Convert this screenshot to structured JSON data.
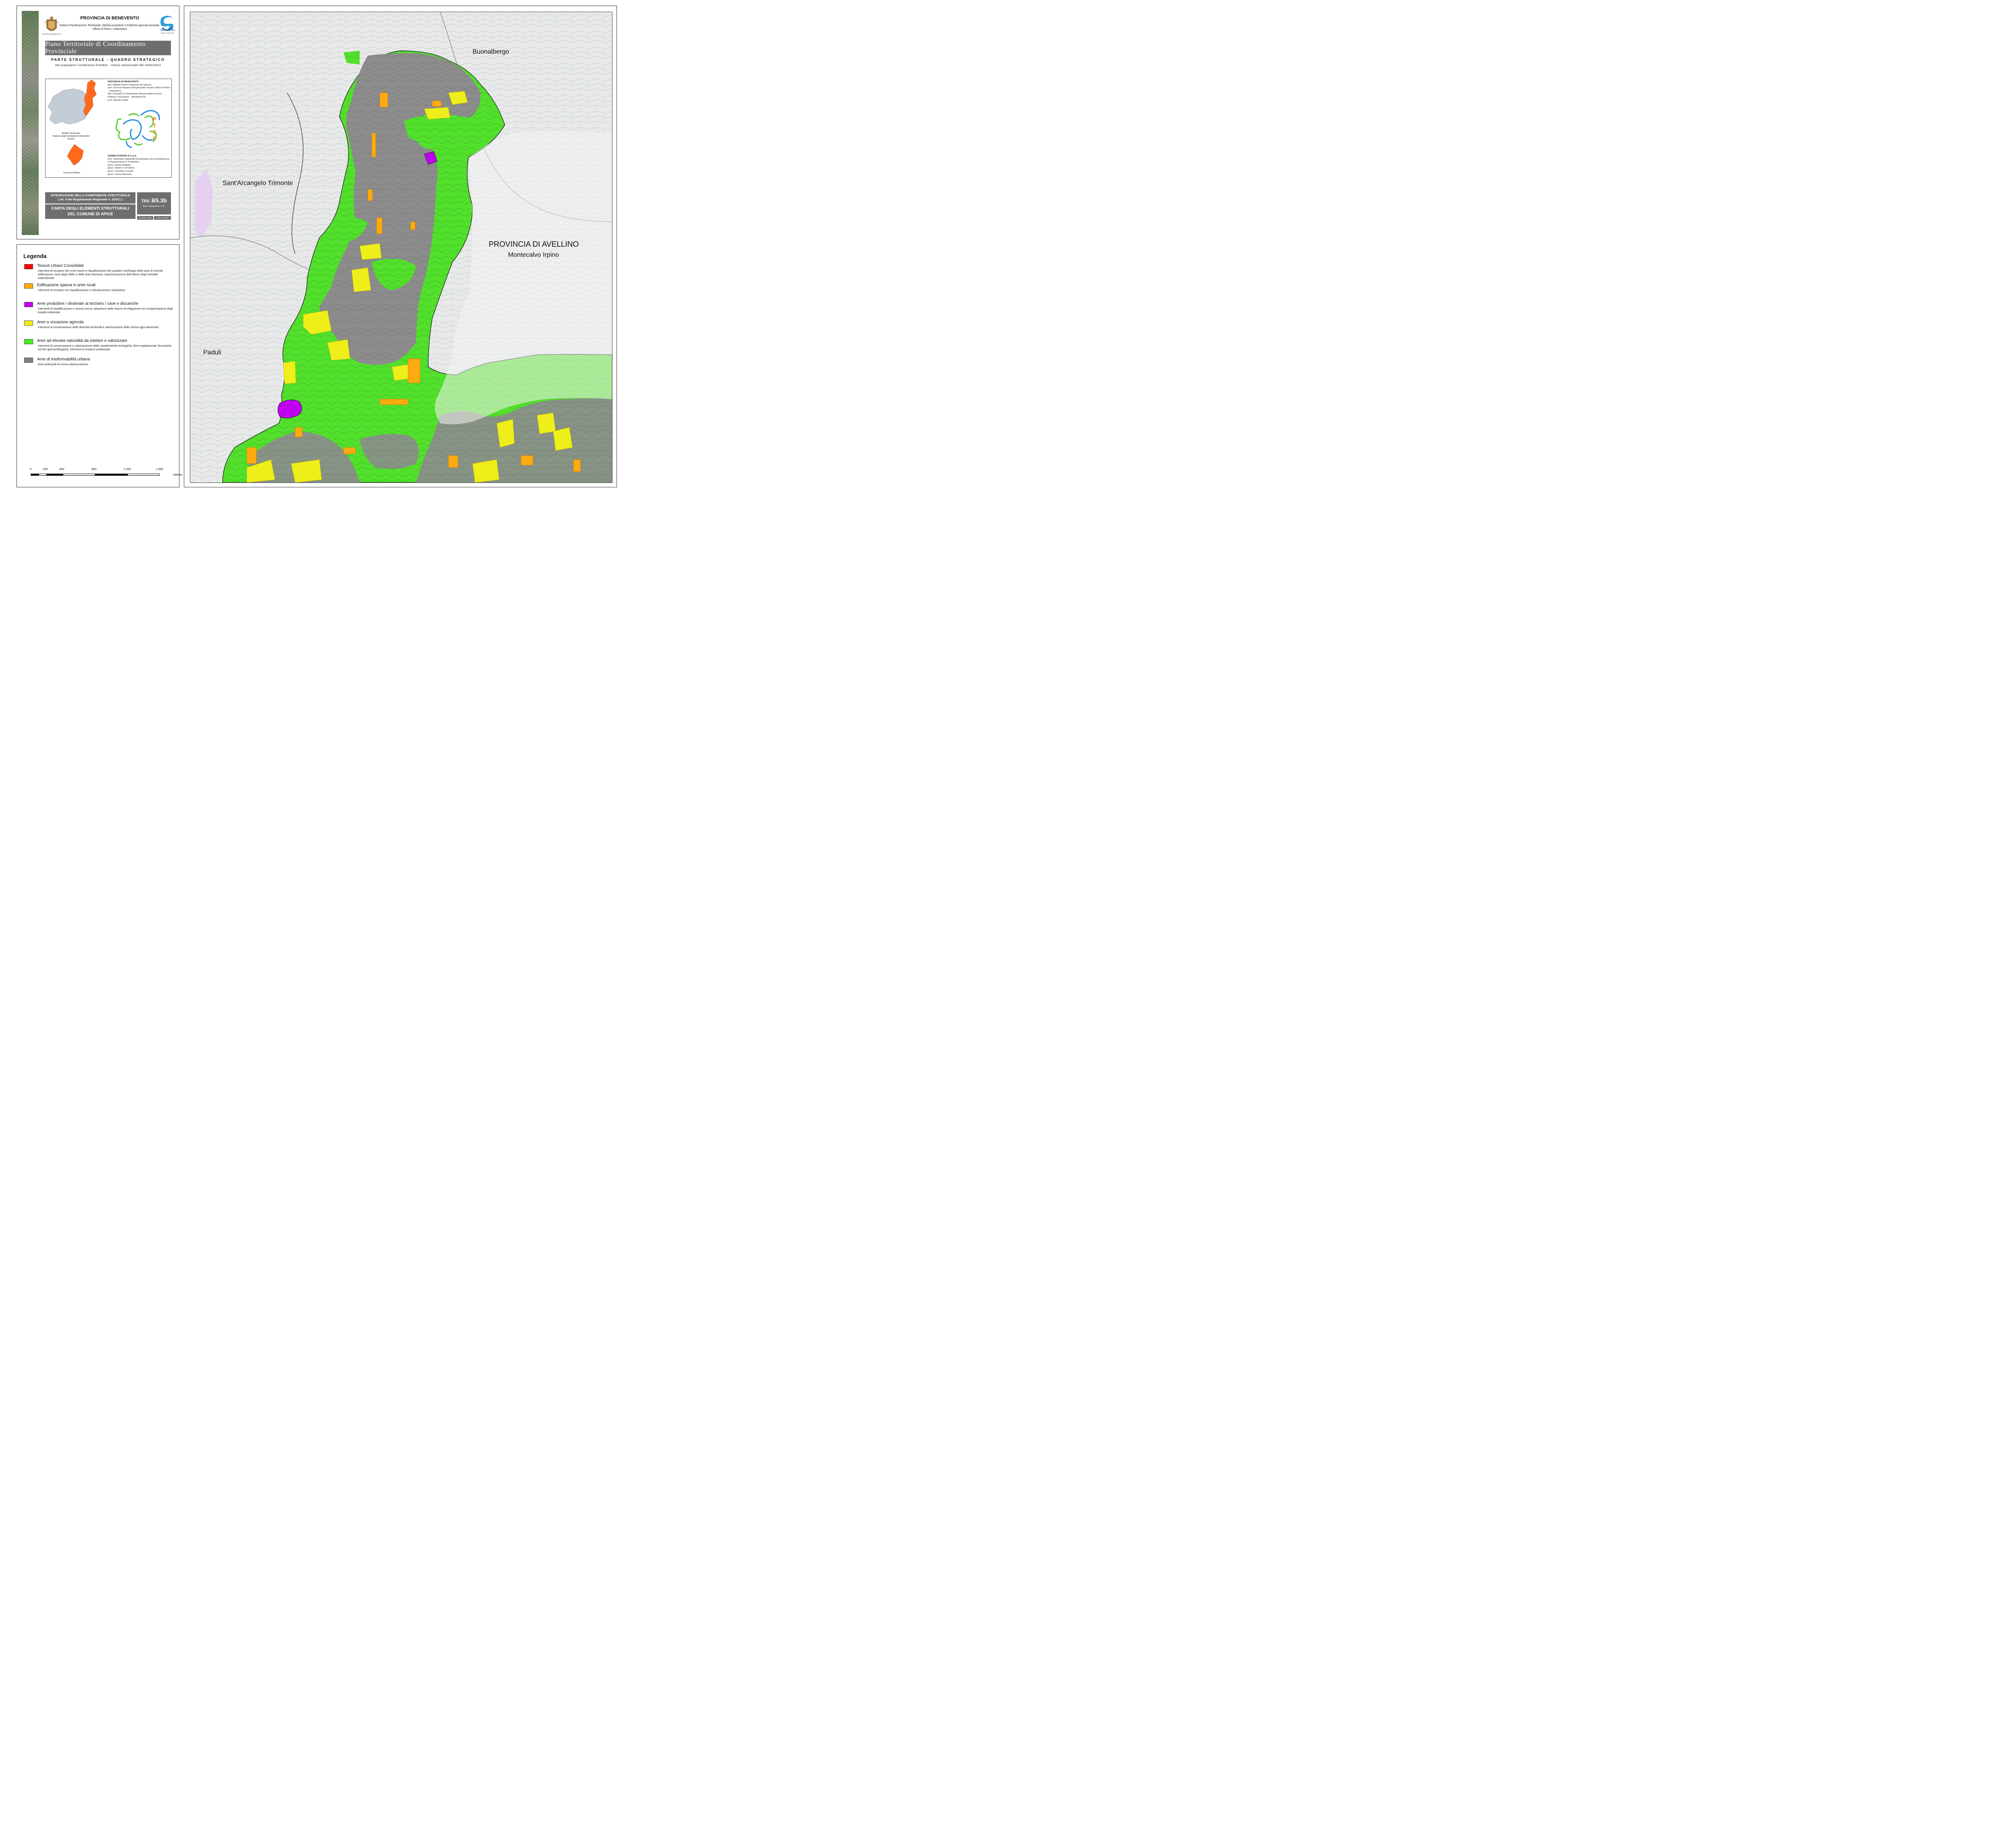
{
  "header": {
    "province": "PROVINCIA DI BENEVENTO",
    "settore": "Settore Pianificazione Territoriale, Attività produttive e Politiche agricolo-forestali, Ufficio di Piano, Urbanistica",
    "crest_caption": "PROVINCIA DI BENEVENTO",
    "logo_caption_1": "sannioeuropa",
    "logo_caption_2": "sapere e saper fare",
    "plan_title": "Piano Territoriale di Coordinamento Provinciale",
    "parte": "PARTE STRUTTURALE - QUADRO STRATEGICO",
    "atti": "Atti preparatori Conferenze d'Ambito - Intesa Istituzionale del 24/02/2012"
  },
  "inset": {
    "team1_title": "PROVINCIA DI BENEVENTO",
    "team1_lines": [
      "dott. Raffaele Bianco (Dirigente del Settore),",
      "arch. Vincenzo Argenio (Responsabile Servizio Ufficio di Piano - Urbanistica),",
      "dott. Pasquale Di Giambattista (Responsabile Servizio Politiche Comunitarie - VIA/VAS/SCA),",
      "arch. Michele Orsillo."
    ],
    "team2_title": "SANNIO EUROPA S.C.p.A.",
    "team2_lines": [
      "arch. Samantha Calandrelli (Coordinatrice Area Pianificazione e Programmazione Territoriale),",
      "geom. Donato Brillante,",
      "geom. Vittorio A. D'Onofrio,",
      "geom. Leonardo Lucarelli,",
      "geom. Serena Mansullo."
    ],
    "caption_ambito": "Ambito Territoriale\nSistema degli Insediamenti Rurali del Fortore",
    "caption_comune": "Comune di Apice",
    "ptcp_letters": "PTCP"
  },
  "footer": {
    "integrazione": "INTEGRAZIONE DELLA COMPONENTE STRUTTURALE",
    "articolo": "( art. 9 del Regolamento Regionale n. 5/2011 )",
    "carta_line1": "CARTA DEGLI ELEMENTI STRUTTURALI",
    "carta_line2": "DEL COMUNE DI APICE",
    "tav_prefix": "TAV.",
    "tav_code": "B5.3b",
    "base": "Base Cartografica C.T.R.",
    "date": "dicembre 2013",
    "scale": "scala 1/10.000"
  },
  "legend": {
    "title": "Legenda",
    "items": [
      {
        "label": "Tessuti Urbani Consolidati",
        "color": "#ff0000",
        "desc": "Interventi di recupero dei centri storici e riqualificazione dei caratteri morfologici delle aree di recente edificazione; riuso degli edifici e delle aree dismessi; massimizzazione dell'utilizzo degli immobili sottoutilizzati."
      },
      {
        "label": "Edificazione sparsa in aree rurali",
        "color": "#ffaa00",
        "desc": "Interventi di recupero e/o riqualificazione e ristrutturazione urbanistica."
      },
      {
        "label": "Aree produttive / destinate al terziario / cave e discariche",
        "color": "#c000f0",
        "desc": "Interventi di riqualificazione e messa norma; attuazione delle misure di mitigazione e/o compensazione degli impatti ambientali."
      },
      {
        "label": "Aree a vocazione agricola",
        "color": "#eeee10",
        "desc": "Interventi di conservazione delle diversità territoriali e valorizzazione delle risorse agro-alimentari."
      },
      {
        "label": "Aree ad elevata naturalità da tutelare e valorizzare",
        "color": "#44ee22",
        "desc": "Interventi di conservazione e valorizzazione delle caratteristiche ecologiche, floro-vegetazionali, faunistiche ed idro-geomorfologiche; interventi di restauro ambientale."
      },
      {
        "label": "Aree di trasformabilità urbana",
        "color": "#808080",
        "desc": "Aree potenziali di nuova urbanizzazione."
      }
    ]
  },
  "scalebar": {
    "ticks": [
      "0",
      "200",
      "400",
      "800",
      "1.200",
      "1.600"
    ],
    "unit": "Meters"
  },
  "map": {
    "labels": {
      "buonalbergo": "Buonalbergo",
      "sant_arcangelo": "Sant'Arcangelo Trimonte",
      "provincia_avellino": "PROVINCIA DI AVELLINO",
      "montecalvo": "Montecalvo Irpino",
      "paduli": "Paduli"
    }
  }
}
